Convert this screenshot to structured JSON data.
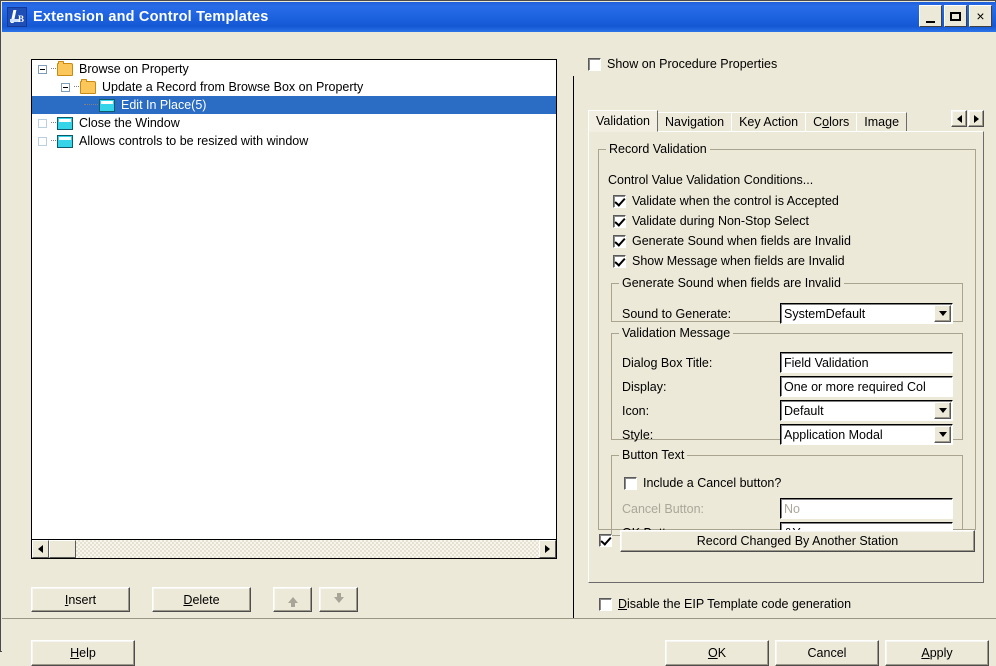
{
  "window": {
    "title": "Extension and Control Templates",
    "icon": "app-icon",
    "buttons": {
      "minimize": "minimize-icon",
      "maximize": "maximize-icon",
      "close": "×"
    }
  },
  "tree": {
    "items": [
      {
        "label": "Browse on Property",
        "icon": "folder-icon",
        "depth": 0,
        "expander": "minus",
        "selected": false
      },
      {
        "label": "Update a Record from Browse Box on Property",
        "icon": "folder-icon",
        "depth": 1,
        "expander": "minus",
        "selected": false
      },
      {
        "label": "Edit In Place(5)",
        "icon": "window-icon",
        "depth": 2,
        "expander": "none",
        "selected": true
      },
      {
        "label": "Close the Window",
        "icon": "window-icon",
        "depth": 0,
        "expander": "empty",
        "selected": false
      },
      {
        "label": "Allows controls to be resized with window",
        "icon": "window-icon",
        "depth": 0,
        "expander": "empty",
        "selected": false
      }
    ],
    "buttons": {
      "insert": "Insert",
      "insert_accel": "I",
      "delete": "Delete",
      "delete_accel": "D",
      "move_up": "move-up-icon",
      "move_down": "move-down-icon"
    }
  },
  "right": {
    "show_on_procedure_properties": {
      "label": "Show on Procedure Properties",
      "checked": false
    },
    "tabs": [
      {
        "label": "Validation",
        "active": true,
        "accel": ""
      },
      {
        "label": "Navigation",
        "active": false,
        "accel": ""
      },
      {
        "label": "Key Action",
        "active": false,
        "accel": ""
      },
      {
        "label": "Colors",
        "active": false,
        "accel": "o"
      },
      {
        "label": "Image",
        "active": false,
        "accel": ""
      }
    ],
    "tab_nav": {
      "prev": "prev-tab-icon",
      "next": "next-tab-icon"
    },
    "record_validation": {
      "legend": "Record Validation",
      "subtitle": "Control Value Validation Conditions...",
      "checks": [
        {
          "label": "Validate when the control is Accepted",
          "checked": true
        },
        {
          "label": "Validate during Non-Stop Select",
          "checked": true
        },
        {
          "label": "Generate Sound when fields are Invalid",
          "checked": true
        },
        {
          "label": "Show Message when fields are Invalid",
          "checked": true
        }
      ],
      "sound_group": {
        "legend": "Generate Sound when fields are Invalid",
        "sound_label": "Sound to Generate:",
        "sound_value": "SystemDefault"
      },
      "message_group": {
        "legend": "Validation Message",
        "fields": [
          {
            "label": "Dialog Box Title:",
            "value": "Field Validation",
            "type": "text",
            "disabled": false
          },
          {
            "label": "Display:",
            "value": "One or more required Col",
            "type": "text",
            "disabled": false
          },
          {
            "label": "Icon:",
            "value": "Default",
            "type": "combo",
            "disabled": false
          },
          {
            "label": "Style:",
            "value": "Application Modal",
            "type": "combo",
            "disabled": false
          }
        ]
      },
      "button_text_group": {
        "legend": "Button Text",
        "include_cancel": {
          "label": "Include a Cancel button?",
          "checked": false
        },
        "fields": [
          {
            "label": "Cancel Button:",
            "value": "No",
            "type": "text",
            "disabled": true
          },
          {
            "label": "OK Button:",
            "value": "&Yes",
            "type": "text",
            "disabled": false
          }
        ]
      }
    },
    "record_changed": {
      "checked": true,
      "button_label": "Record Changed By Another Station"
    },
    "disable_eip": {
      "label": "Disable the EIP Template code generation",
      "accel": "D",
      "checked": false
    }
  },
  "dialog_buttons": {
    "help": "Help",
    "help_accel": "H",
    "ok": "OK",
    "ok_accel": "O",
    "cancel": "Cancel",
    "apply": "Apply",
    "apply_accel": "A"
  }
}
